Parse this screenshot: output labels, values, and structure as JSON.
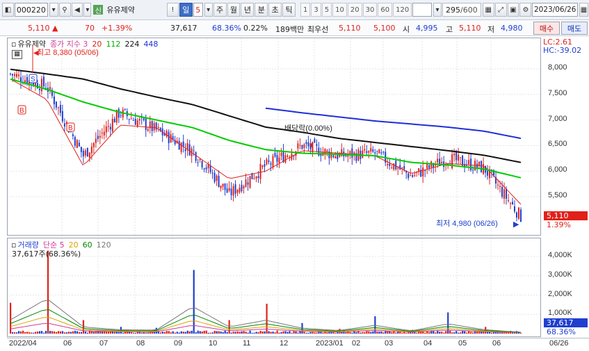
{
  "toolbar": {
    "code": "000220",
    "sin_badge": "신",
    "stock_name": "유유제약",
    "period_active": "일",
    "period_count": "5",
    "periods": [
      "주",
      "월",
      "년",
      "분",
      "초",
      "틱"
    ],
    "minute_numbers": [
      "1",
      "3",
      "5",
      "10",
      "20",
      "30",
      "60",
      "120"
    ],
    "bars": "295",
    "bars_total": "/600",
    "date": "2023/06/26"
  },
  "quote": {
    "price": "5,110",
    "change_arrow": "▲",
    "change": "70",
    "change_pct": "+1.39%",
    "volume": "37,617",
    "volume_pct": "68.36%",
    "turnover": "0.22%",
    "amount": "189백만",
    "best_bid_label": "최우선",
    "ask": "5,110",
    "bid": "5,100",
    "open_label": "시",
    "open": "4,995",
    "high_label": "고",
    "high": "5,110",
    "low_label": "저",
    "low": "4,980",
    "buy_button": "매수",
    "sell_button": "매도"
  },
  "price_panel": {
    "stock_label": "유유제약",
    "legend_ma_title": "종가 지수 3",
    "legend_ma": [
      "20",
      "112",
      "224",
      "448"
    ],
    "max_annotation": "최고 8,380 (05/06)",
    "min_annotation": "최저 4,980 (06/26)",
    "dividend_annotation": "배당락(0.00%)",
    "lc": "LC:2.61",
    "hc": "HC:-39.02",
    "last_price": "5,110",
    "last_pct": "1.39%",
    "marker_s": "S",
    "marker_b": "B"
  },
  "volume_panel": {
    "legend_title": "거래량",
    "legend_sub": "단순 5",
    "legend_ma": [
      "20",
      "60",
      "120"
    ],
    "info": "37,617주(68.36%)",
    "last_volume": "37,617",
    "last_pct": "68.36%"
  },
  "colors": {
    "up": "#e0211a",
    "down": "#1f3fcf",
    "ma20": "#e0211a",
    "ma112": "#00cc00",
    "ma224": "#111111",
    "ma448": "#1f2fd6"
  },
  "chart_data": [
    {
      "type": "line",
      "title": "유유제약",
      "xlabel": "",
      "ylabel": "",
      "ylim": [
        5000,
        8000
      ],
      "yticks": [
        "8,000",
        "7,500",
        "7,000",
        "6,500",
        "6,000",
        "5,500"
      ],
      "xticks": [
        "2022/04",
        "06",
        "07",
        "08",
        "09",
        "10",
        "11",
        "12",
        "2023/01",
        "02",
        "03",
        "04",
        "05",
        "06",
        "06/26"
      ],
      "grid": true,
      "x": [
        "2022/04",
        "2022/05",
        "2022/06",
        "2022/07",
        "2022/08",
        "2022/09",
        "2022/10",
        "2022/11",
        "2022/12",
        "2023/01",
        "2023/02",
        "2023/03",
        "2023/04",
        "2023/05",
        "2023/06"
      ],
      "series": [
        {
          "name": "종가",
          "values": [
            7900,
            7650,
            6300,
            7150,
            6800,
            6400,
            5550,
            6100,
            6500,
            6300,
            6350,
            5900,
            6250,
            6050,
            5110
          ]
        },
        {
          "name": "20",
          "values": [
            7800,
            7400,
            6100,
            6900,
            6850,
            6350,
            5850,
            6000,
            6400,
            6350,
            6300,
            5950,
            6150,
            6100,
            5350
          ]
        },
        {
          "name": "112",
          "values": [
            7800,
            7600,
            7350,
            7150,
            7000,
            6850,
            6600,
            6420,
            6350,
            6330,
            6300,
            6170,
            6120,
            6040,
            5870
          ]
        },
        {
          "name": "224",
          "values": [
            7990,
            7900,
            7800,
            7610,
            7450,
            7300,
            7080,
            6860,
            6760,
            6640,
            6560,
            6480,
            6400,
            6310,
            6170
          ]
        },
        {
          "name": "448",
          "values": [
            null,
            null,
            null,
            null,
            null,
            null,
            null,
            7230,
            7140,
            7060,
            6980,
            6920,
            6860,
            6780,
            6640
          ]
        }
      ]
    },
    {
      "type": "bar",
      "title": "거래량",
      "ylim": [
        0,
        4500000
      ],
      "yticks": [
        "4,000K",
        "3,000K",
        "2,000K",
        "1,000K"
      ],
      "x": [
        "2022/04",
        "2022/05",
        "2022/06",
        "2022/07",
        "2022/08",
        "2022/09",
        "2022/10",
        "2022/11",
        "2022/12",
        "2023/01",
        "2023/02",
        "2023/03",
        "2023/04",
        "2023/05",
        "2023/06"
      ],
      "values": [
        1600000,
        4300000,
        700000,
        350000,
        300000,
        3300000,
        700000,
        1550000,
        550000,
        250000,
        900000,
        200000,
        1100000,
        350000,
        37617
      ]
    }
  ]
}
